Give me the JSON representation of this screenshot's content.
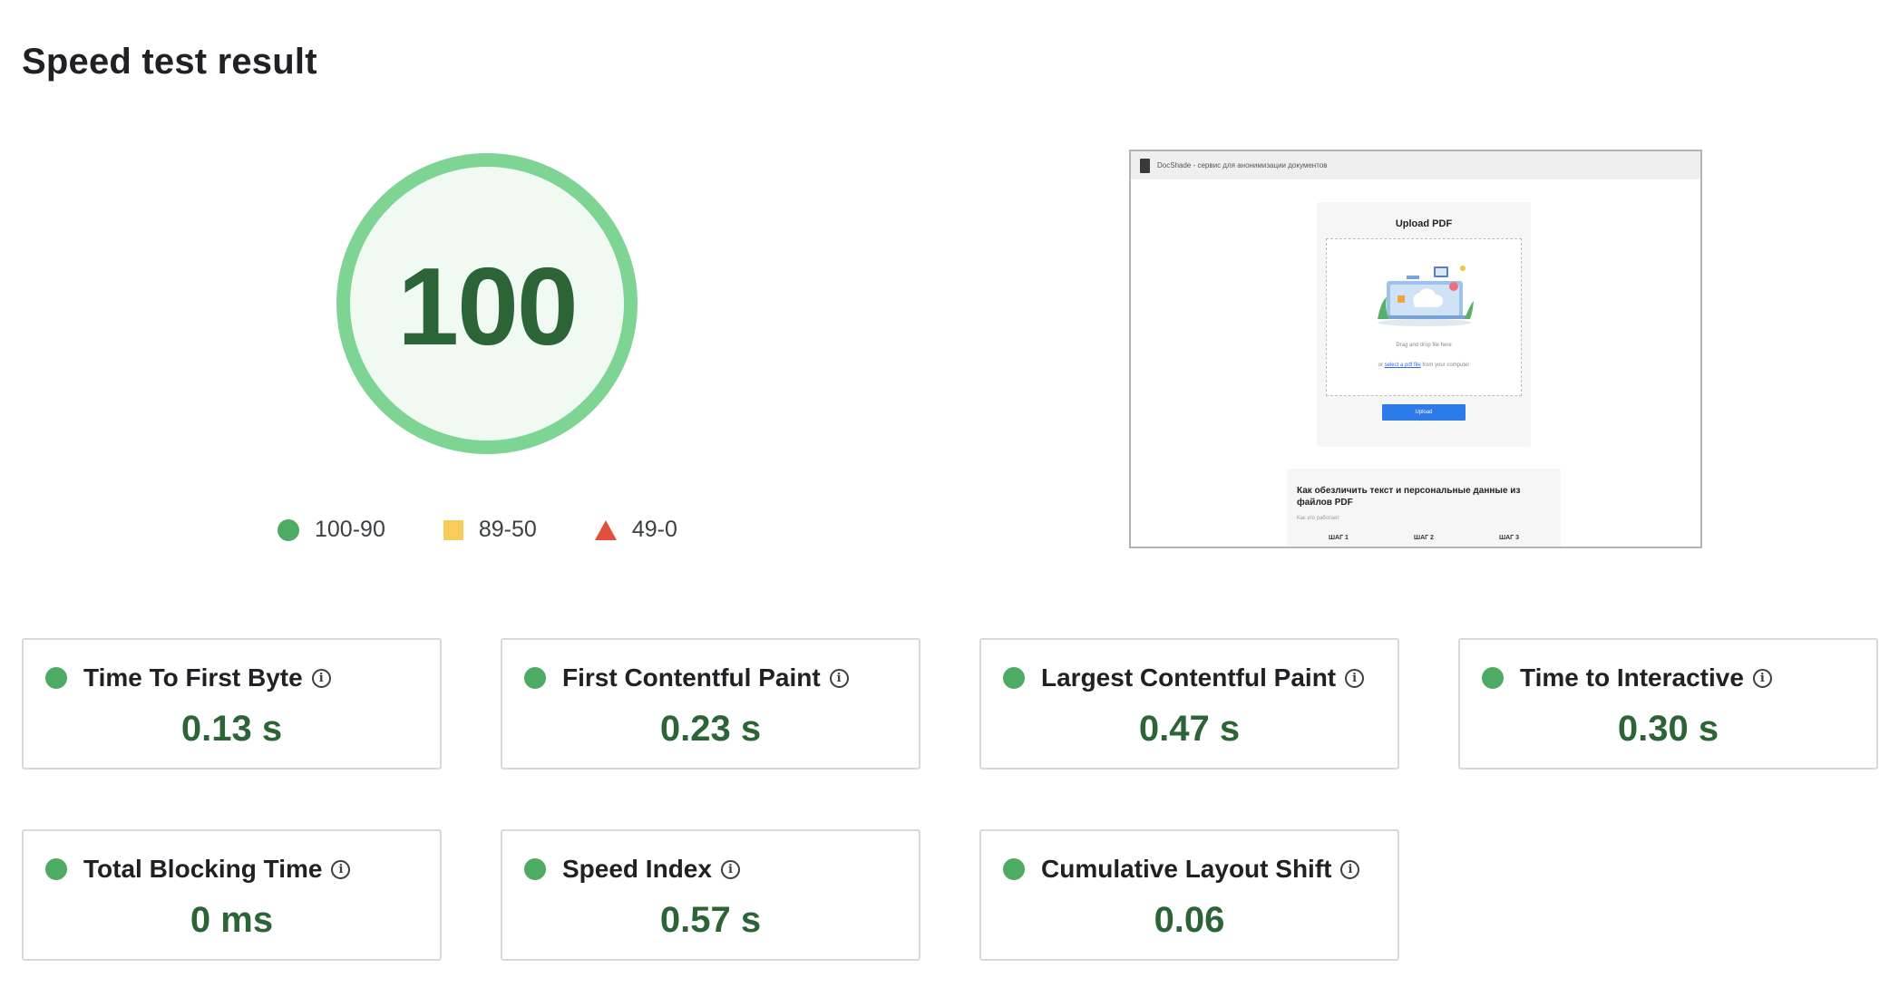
{
  "page": {
    "title": "Speed test result"
  },
  "score": {
    "value": "100",
    "color": "#7ed492",
    "text_color": "#2d6437"
  },
  "legend": [
    {
      "shape": "circle",
      "range": "100-90",
      "color": "#4eab63"
    },
    {
      "shape": "square",
      "range": "89-50",
      "color": "#f8cc5a"
    },
    {
      "shape": "triangle",
      "range": "49-0",
      "color": "#e2503c"
    }
  ],
  "preview": {
    "tab_title": "DocShade - сервис для анонимизации документов",
    "upload_title": "Upload PDF",
    "drop_hint": "Drag and drop file here",
    "select_prefix": "or",
    "select_link": "select a pdf file",
    "select_suffix": "from your computer",
    "upload_button": "Upload",
    "section_title": "Как обезличить текст и персональные данные из файлов PDF",
    "section_sub": "Как это работает",
    "steps": [
      "ШАГ 1",
      "ШАГ 2",
      "ШАГ 3"
    ]
  },
  "metrics": [
    {
      "label": "Time To First Byte",
      "value": "0.13 s",
      "status": "good",
      "icon": "info-icon"
    },
    {
      "label": "First Contentful Paint",
      "value": "0.23 s",
      "status": "good",
      "icon": "info-icon"
    },
    {
      "label": "Largest Contentful Paint",
      "value": "0.47 s",
      "status": "good",
      "icon": "info-icon"
    },
    {
      "label": "Time to Interactive",
      "value": "0.30 s",
      "status": "good",
      "icon": "info-icon"
    },
    {
      "label": "Total Blocking Time",
      "value": "0 ms",
      "status": "good",
      "icon": "info-icon"
    },
    {
      "label": "Speed Index",
      "value": "0.57 s",
      "status": "good",
      "icon": "info-icon"
    },
    {
      "label": "Cumulative Layout Shift",
      "value": "0.06",
      "status": "good",
      "icon": "info-icon"
    }
  ],
  "colors": {
    "good": "#4eab63",
    "value_text": "#2d6437",
    "card_border": "#d9d9d9"
  }
}
